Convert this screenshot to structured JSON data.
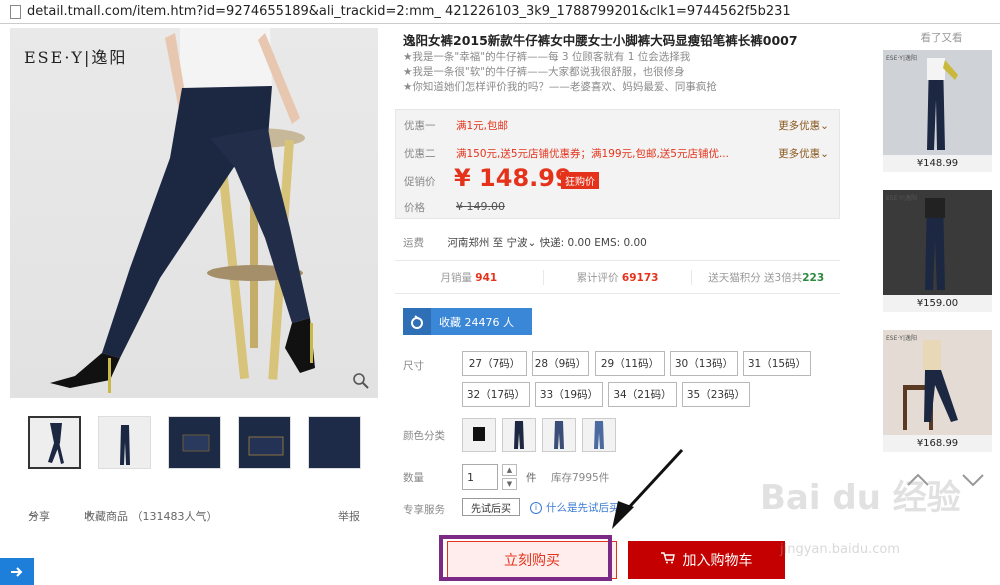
{
  "browser": {
    "url": "detail.tmall.com/item.htm?id=9274655189&ali_trackid=2:mm_              421226103_3k9_1788799201&clk1=9744562f5b231"
  },
  "gallery": {
    "brand": "ESE·Y|逸阳",
    "share": "分享",
    "favorite": "收藏商品 （131483人气）",
    "report": "举报"
  },
  "product": {
    "title": "逸阳女裤2015新款牛仔裤女中腰女士小脚裤大码显瘦铅笔裤长裤0007",
    "taglines": [
      "★我是一条\"幸福\"的牛仔裤——每 3 位顾客就有 1 位会选择我",
      "★我是一条很\"软\"的牛仔裤——大家都说我很舒服，也很修身",
      "★你知道她们怎样评价我的吗？——老婆喜欢、妈妈最爱、同事疯抢"
    ]
  },
  "price_box": {
    "promo1_label": "优惠一",
    "promo1_value": "满1元,包邮",
    "promo1_more": "更多优惠⌄",
    "promo2_label": "优惠二",
    "promo2_value": "满150元,送5元店铺优惠券；满199元,包邮,送5元店铺优...",
    "promo2_more": "更多优惠⌄",
    "sale_label": "促销价",
    "sale_price": "¥ 148.99",
    "sale_tag": "狂购价",
    "price_label": "价格",
    "original_price": "¥ 149.00"
  },
  "shipping": {
    "label": "运费",
    "value": "河南郑州  至 宁波⌄  快递: 0.00 EMS: 0.00"
  },
  "stats": {
    "monthly_label": "月销量",
    "monthly_value": "941",
    "reviews_label": "累计评价",
    "reviews_value": "69173",
    "points_label": "送天猫积分 送3倍共",
    "points_value": "223"
  },
  "collect": {
    "label": "收藏 24476 人"
  },
  "size": {
    "label": "尺寸",
    "options": [
      "27（7码）",
      "28（9码）",
      "29（11码）",
      "30（13码）",
      "31（15码）",
      "32（17码）",
      "33（19码）",
      "34（21码）",
      "35（23码）"
    ]
  },
  "color": {
    "label": "颜色分类"
  },
  "quantity": {
    "label": "数量",
    "value": "1",
    "unit": "件",
    "stock": "库存7995件"
  },
  "service": {
    "label": "专享服务",
    "trial": "先试后买",
    "help": "什么是先试后买"
  },
  "actions": {
    "buy_now": "立刻购买",
    "add_cart": "加入购物车"
  },
  "recommend": {
    "title": "看了又看",
    "items": [
      {
        "price": "¥148.99"
      },
      {
        "price": "¥159.00"
      },
      {
        "price": "¥168.99"
      }
    ]
  },
  "watermark": {
    "logo": "Bai du 经验",
    "url": "jingyan.baidu.com"
  }
}
